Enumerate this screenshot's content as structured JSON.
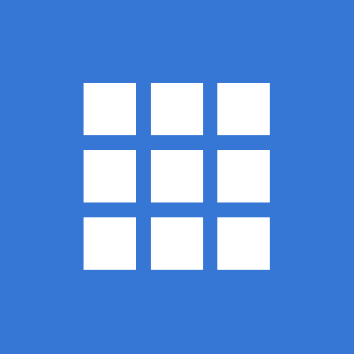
{
  "tile": {
    "background_color": "#3676d4",
    "icon": "grid-icon",
    "icon_color": "#ffffff"
  }
}
